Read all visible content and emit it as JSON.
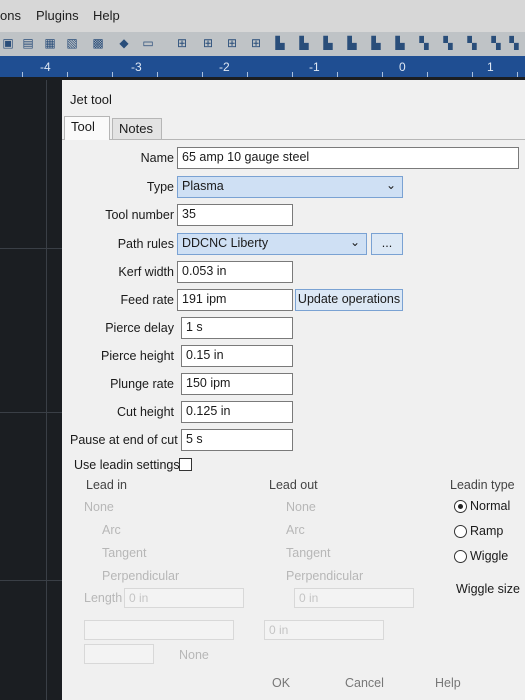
{
  "menubar": {
    "items": [
      "ons",
      "Plugins",
      "Help"
    ]
  },
  "toolbar": {
    "icons": [
      "toolbar-icon-1",
      "toolbar-icon-2",
      "toolbar-icon-3",
      "toolbar-icon-4",
      "toolbar-icon-5",
      "toolbar-icon-6",
      "toolbar-icon-7",
      "toolbar-icon-8",
      "toolbar-icon-9",
      "toolbar-icon-10",
      "toolbar-icon-11",
      "toolbar-icon-12",
      "toolbar-icon-13",
      "toolbar-icon-14",
      "toolbar-icon-15",
      "toolbar-icon-16",
      "toolbar-icon-17",
      "toolbar-icon-18",
      "toolbar-icon-19",
      "toolbar-icon-20",
      "toolbar-icon-21",
      "toolbar-icon-22",
      "toolbar-icon-23",
      "toolbar-icon-24"
    ]
  },
  "ruler": {
    "ticks": [
      "-4",
      "-3",
      "-2",
      "-1",
      "0",
      "1"
    ]
  },
  "dialog": {
    "title": "Jet tool",
    "tabs": [
      "Tool",
      "Notes"
    ],
    "fields": {
      "name": {
        "label": "Name",
        "value": "65 amp 10 gauge steel"
      },
      "type": {
        "label": "Type",
        "value": "Plasma"
      },
      "tool_number": {
        "label": "Tool number",
        "value": "35"
      },
      "path_rules": {
        "label": "Path rules",
        "value": "DDCNC Liberty",
        "button": "..."
      },
      "kerf_width": {
        "label": "Kerf width",
        "value": "0.053 in"
      },
      "feed_rate": {
        "label": "Feed rate",
        "value": "191 ipm",
        "button": "Update operations"
      },
      "pierce_delay": {
        "label": "Pierce delay",
        "value": "1 s"
      },
      "pierce_height": {
        "label": "Pierce height",
        "value": "0.15 in"
      },
      "plunge_rate": {
        "label": "Plunge rate",
        "value": "150 ipm"
      },
      "cut_height": {
        "label": "Cut height",
        "value": "0.125 in"
      },
      "pause_end": {
        "label": "Pause at end of cut",
        "value": "5 s"
      }
    },
    "use_leadin": {
      "label": "Use leadin settings",
      "checked": false
    },
    "lead_in": {
      "label": "Lead in",
      "options": [
        "None",
        "Arc",
        "Tangent",
        "Perpendicular"
      ],
      "length_label": "Length",
      "length_value": "0 in"
    },
    "lead_out": {
      "label": "Lead out",
      "options": [
        "None",
        "Arc",
        "Tangent",
        "Perpendicular"
      ],
      "length_value": "0 in"
    },
    "leadin_type": {
      "label": "Leadin type",
      "options": [
        "Normal",
        "Ramp",
        "Wiggle"
      ],
      "selected": "Normal"
    },
    "wiggle_size": {
      "label": "Wiggle size"
    },
    "extra": {
      "value_0in": "0 in",
      "none": "None"
    },
    "footer": {
      "ok": "OK",
      "cancel": "Cancel",
      "help": "Help"
    }
  }
}
